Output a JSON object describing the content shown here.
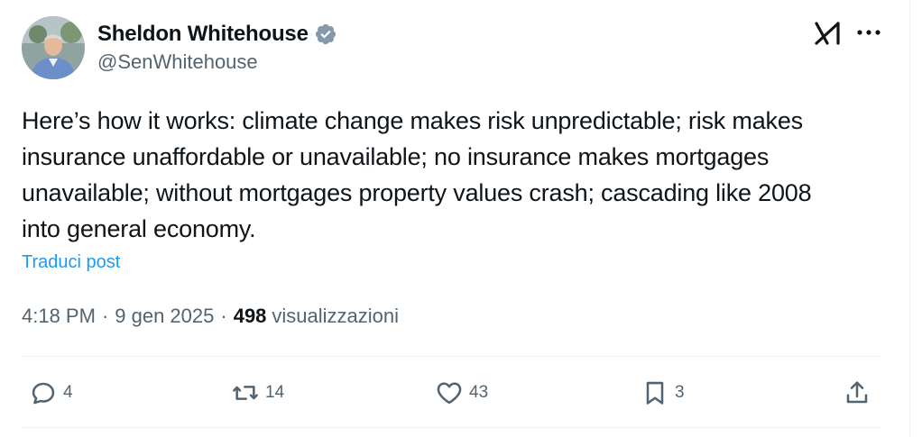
{
  "author": {
    "display_name": "Sheldon Whitehouse",
    "handle": "@SenWhitehouse",
    "avatar_icon": "profile-photo",
    "verified_icon": "verified-badge-icon"
  },
  "header_icons": {
    "grok": "grok-icon",
    "more": "more-horizontal-icon"
  },
  "tweet": {
    "text": "Here’s how it works: climate change makes risk unpredictable; risk makes insurance unaffordable or unavailable; no insurance makes mortgages unavailable; without mortgages property values crash; cascading like 2008 into general economy.",
    "translate_label": "Traduci post"
  },
  "meta": {
    "time": "4:18 PM",
    "separator1": "·",
    "date": "9 gen 2025",
    "separator2": "·",
    "views_count": "498",
    "views_label": "visualizzazioni"
  },
  "actions": {
    "replies": "4",
    "reposts": "14",
    "likes": "43",
    "bookmarks": "3"
  },
  "colors": {
    "text": "#0f1419",
    "secondary": "#536471",
    "link": "#1d9bf0",
    "verified": "#829aab"
  }
}
